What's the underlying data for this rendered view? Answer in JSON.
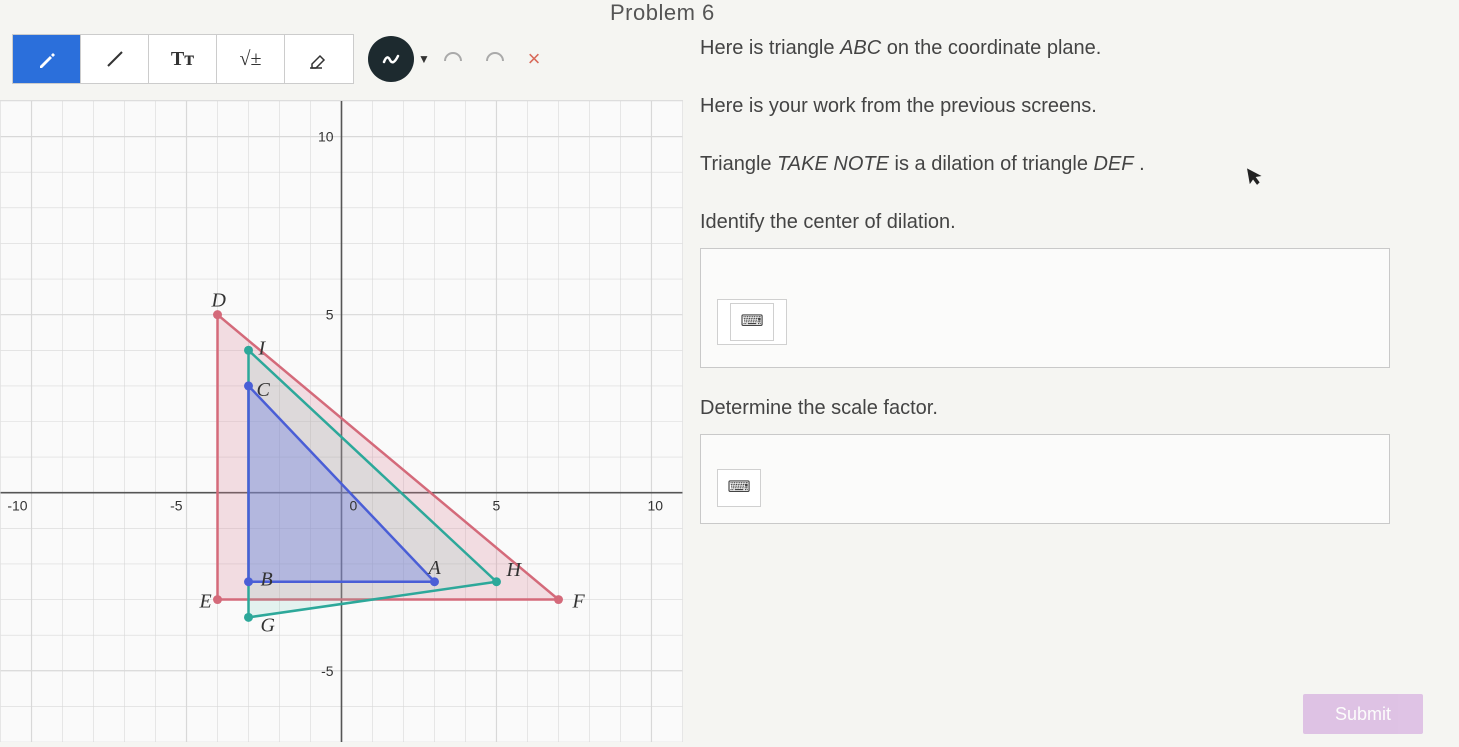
{
  "header": {
    "title": "Problem 6"
  },
  "toolbar": {
    "pen_icon": "pen-icon",
    "line_icon": "line-icon",
    "text_label": "Tᴛ",
    "math_label": "√±",
    "eraser_icon": "eraser-icon",
    "scribble_icon": "scribble-icon",
    "undo_icon": "undo-icon",
    "redo_icon": "redo-icon",
    "close_label": "×"
  },
  "problem": {
    "line1_a": "Here is triangle ",
    "line1_b": "ABC",
    "line1_c": " on the coordinate plane.",
    "line2": "Here is your work from the previous screens.",
    "line3_a": "Triangle ",
    "line3_b": "TAKE NOTE",
    "line3_c": " is a dilation of triangle ",
    "line3_d": "DEF",
    "line3_e": " .",
    "prompt1": "Identify the center of dilation.",
    "prompt2": "Determine the scale factor.",
    "submit": "Submit",
    "keyboard_icon": "⌨"
  },
  "chart_data": {
    "type": "scatter",
    "title": "",
    "xlabel": "",
    "ylabel": "",
    "xlim": [
      -11,
      11
    ],
    "ylim": [
      -7,
      11
    ],
    "xticks": [
      -10,
      -5,
      0,
      5,
      10
    ],
    "yticks": [
      -5,
      5,
      10
    ],
    "points": {
      "D": [
        -4,
        5
      ],
      "I": [
        -3,
        4
      ],
      "C": [
        -3,
        3
      ],
      "E": [
        -4,
        -3
      ],
      "B": [
        -3,
        -2.5
      ],
      "G": [
        -3,
        -3.5
      ],
      "A": [
        3,
        -2.5
      ],
      "H": [
        5,
        -2.5
      ],
      "F": [
        7,
        -3
      ]
    },
    "triangles": [
      {
        "name": "DEF",
        "color": "#d46a7a",
        "fill": "rgba(220,130,150,0.25)",
        "vertices": [
          "D",
          "E",
          "F"
        ]
      },
      {
        "name": "IGH_outer",
        "color": "#2da89a",
        "fill": "rgba(100,200,180,0.15)",
        "vertices": [
          "I",
          "G",
          "H"
        ]
      },
      {
        "name": "ABC",
        "color": "#4a5ed6",
        "fill": "rgba(100,120,230,0.35)",
        "vertices": [
          "C",
          "B",
          "A"
        ]
      }
    ]
  }
}
